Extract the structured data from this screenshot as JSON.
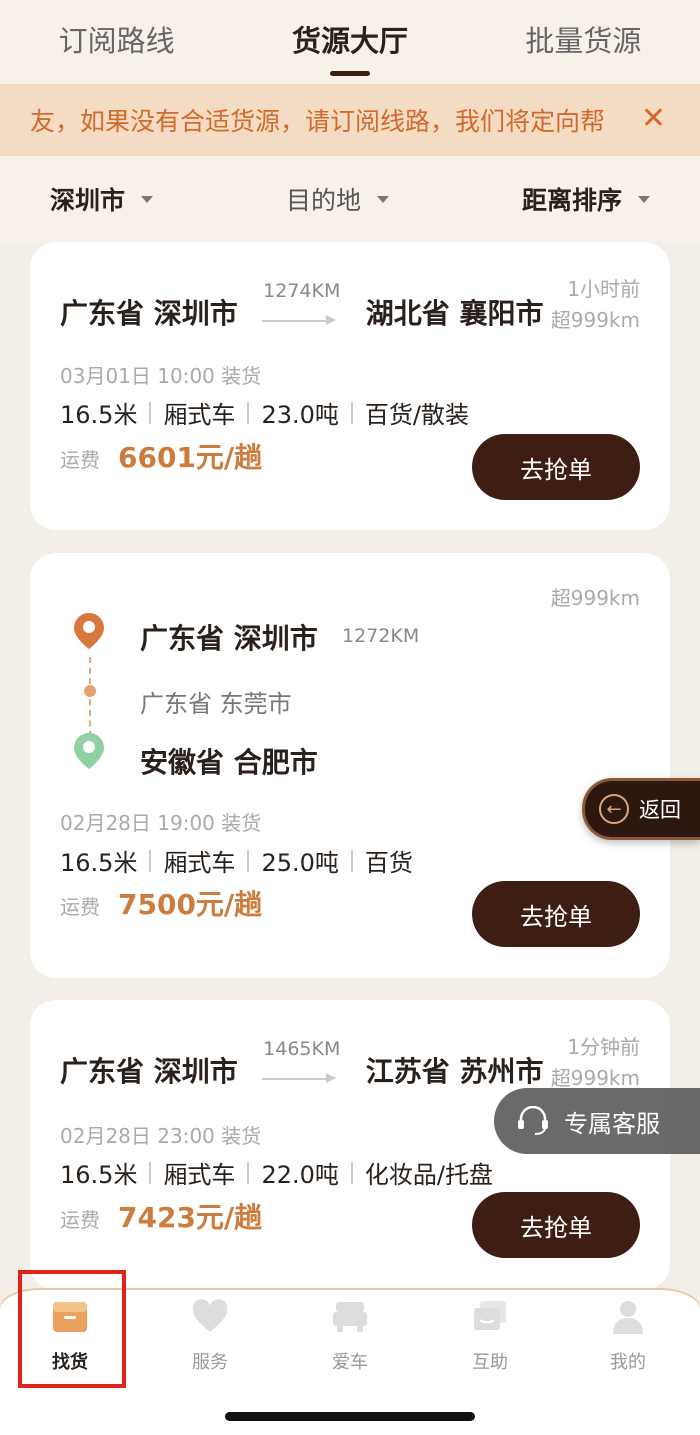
{
  "tabs": [
    "订阅路线",
    "货源大厅",
    "批量货源"
  ],
  "notice": {
    "text": "友，如果没有合适货源，请订阅线路，我们将定向帮",
    "close": "✕"
  },
  "filters": {
    "origin": "深圳市",
    "destination": "目的地",
    "sort": "距离排序"
  },
  "cards": [
    {
      "time": "1小时前",
      "distance_limit": "超999km",
      "from": "广东省 深圳市",
      "km": "1274KM",
      "to": "湖北省 襄阳市",
      "load_time": "03月01日 10:00 装货",
      "length": "16.5米",
      "vehicle": "厢式车",
      "weight": "23.0吨",
      "goods": "百货/散装",
      "fee_label": "运费",
      "fee": "6601元/趟",
      "button": "去抢单"
    },
    {
      "distance_limit": "超999km",
      "from": "广东省 深圳市",
      "km": "1272KM",
      "via": "广东省 东莞市",
      "to": "安徽省 合肥市",
      "load_time": "02月28日 19:00 装货",
      "length": "16.5米",
      "vehicle": "厢式车",
      "weight": "25.0吨",
      "goods": "百货",
      "fee_label": "运费",
      "fee": "7500元/趟",
      "button": "去抢单"
    },
    {
      "time": "1分钟前",
      "distance_limit": "超999km",
      "from": "广东省 深圳市",
      "km": "1465KM",
      "to": "江苏省 苏州市",
      "load_time": "02月28日 23:00 装货",
      "length": "16.5米",
      "vehicle": "厢式车",
      "weight": "22.0吨",
      "goods": "化妆品/托盘",
      "fee_label": "运费",
      "fee": "7423元/趟",
      "button": "去抢单"
    }
  ],
  "floating": {
    "back": "返回",
    "service": "专属客服"
  },
  "nav": [
    {
      "label": "找货",
      "icon": "box-icon"
    },
    {
      "label": "服务",
      "icon": "heart-icon"
    },
    {
      "label": "爱车",
      "icon": "car-icon"
    },
    {
      "label": "互助",
      "icon": "chat-icon"
    },
    {
      "label": "我的",
      "icon": "user-icon"
    }
  ],
  "colors": {
    "accent": "#cc7c3c",
    "button": "#3e1e12",
    "highlight": "#e0241b"
  }
}
